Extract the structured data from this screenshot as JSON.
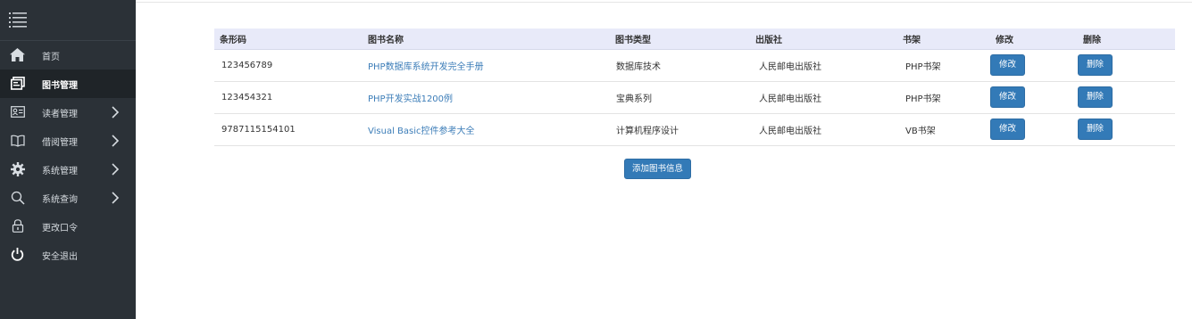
{
  "sidebar": {
    "items": [
      {
        "label": "首页",
        "icon": "home-icon",
        "active": false,
        "has_arrow": false
      },
      {
        "label": "图书管理",
        "icon": "books-icon",
        "active": true,
        "has_arrow": false
      },
      {
        "label": "读者管理",
        "icon": "id-card-icon",
        "active": false,
        "has_arrow": true
      },
      {
        "label": "借阅管理",
        "icon": "open-book-icon",
        "active": false,
        "has_arrow": true
      },
      {
        "label": "系统管理",
        "icon": "gear-icon",
        "active": false,
        "has_arrow": true
      },
      {
        "label": "系统查询",
        "icon": "search-icon",
        "active": false,
        "has_arrow": true
      },
      {
        "label": "更改口令",
        "icon": "lock-icon",
        "active": false,
        "has_arrow": false
      },
      {
        "label": "安全退出",
        "icon": "power-icon",
        "active": false,
        "has_arrow": false
      }
    ]
  },
  "table": {
    "headers": [
      "条形码",
      "图书名称",
      "图书类型",
      "出版社",
      "书架",
      "修改",
      "删除"
    ],
    "rows": [
      {
        "barcode": "123456789",
        "name": "PHP数据库系统开发完全手册",
        "type": "数据库技术",
        "publisher": "人民邮电出版社",
        "shelf": "PHP书架",
        "edit": "修改",
        "delete": "删除"
      },
      {
        "barcode": "123454321",
        "name": "PHP开发实战1200例",
        "type": "宝典系列",
        "publisher": "人民邮电出版社",
        "shelf": "PHP书架",
        "edit": "修改",
        "delete": "删除"
      },
      {
        "barcode": "9787115154101",
        "name": "Visual Basic控件参考大全",
        "type": "计算机程序设计",
        "publisher": "人民邮电出版社",
        "shelf": "VB书架",
        "edit": "修改",
        "delete": "删除"
      }
    ]
  },
  "add_button_label": "添加图书信息",
  "colors": {
    "sidebar_bg": "#2b3137",
    "sidebar_active_bg": "#1f2428",
    "header_bg": "#e8eaf9",
    "button_primary": "#337ab7",
    "link_text": "#3c7db8"
  }
}
